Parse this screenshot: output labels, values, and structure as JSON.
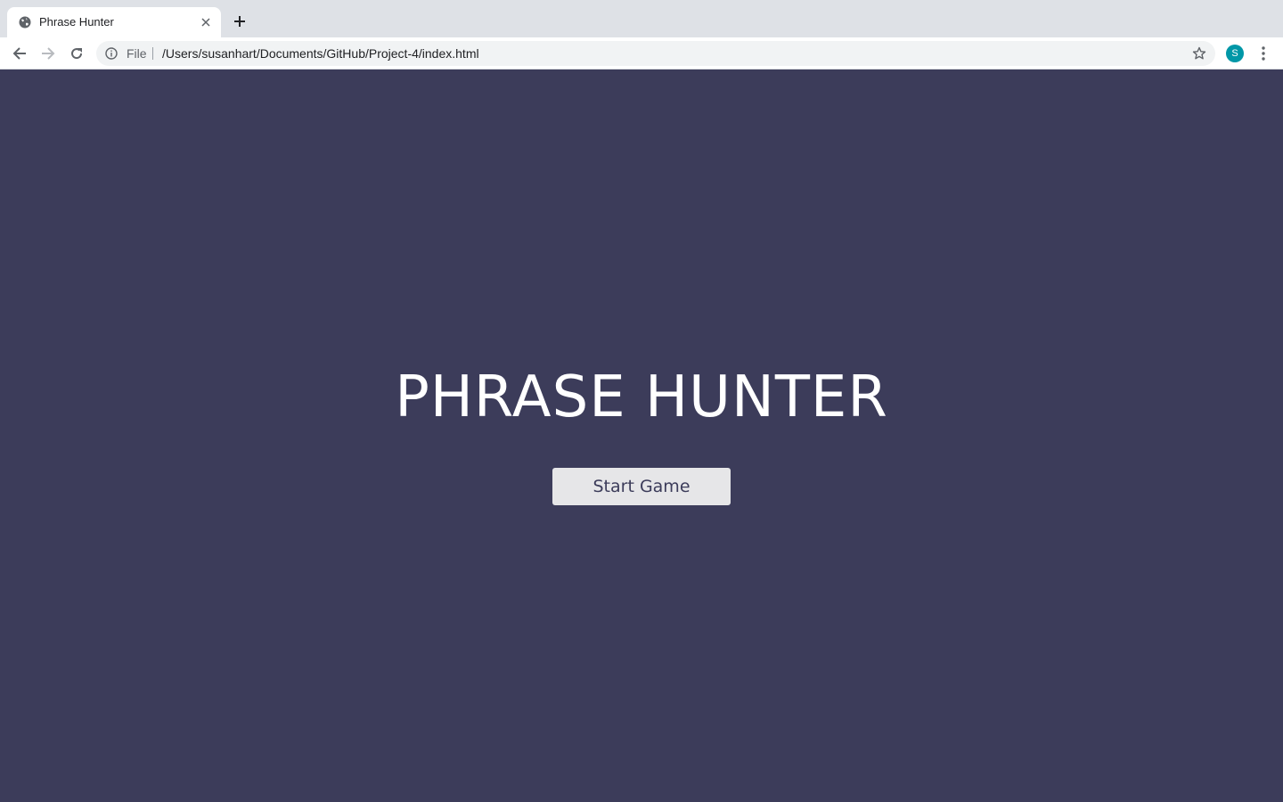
{
  "browser": {
    "tab": {
      "title": "Phrase Hunter",
      "favicon": "globe-icon"
    },
    "address_bar": {
      "scheme_label": "File",
      "url": "/Users/susanhart/Documents/GitHub/Project-4/index.html"
    },
    "profile_initial": "S",
    "colors": {
      "tabbar": "#dee1e6",
      "avatar": "#0097a7"
    }
  },
  "page": {
    "title": "PHRASE HUNTER",
    "start_button_label": "Start Game",
    "colors": {
      "background": "#3c3c5a",
      "button": "#e6e6e8",
      "title": "#ffffff"
    }
  }
}
